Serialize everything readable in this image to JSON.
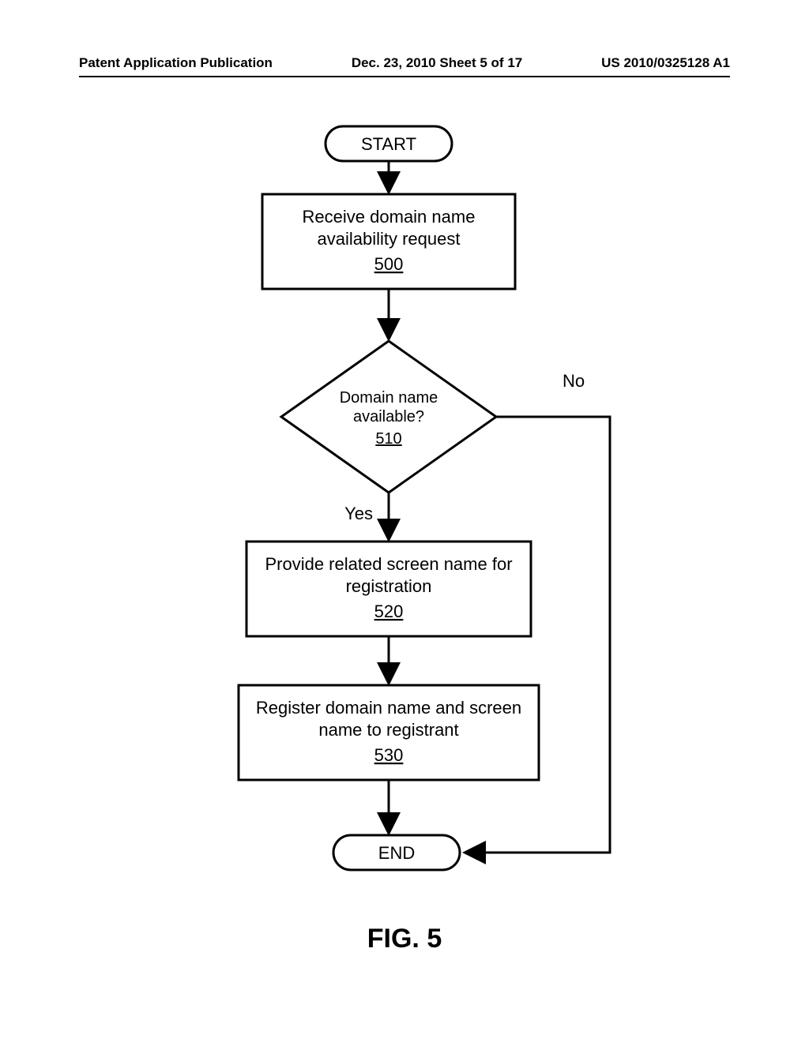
{
  "header": {
    "left": "Patent Application Publication",
    "center": "Dec. 23, 2010  Sheet 5 of 17",
    "right": "US 2010/0325128 A1"
  },
  "flowchart": {
    "start": "START",
    "end": "END",
    "nodes": {
      "n500": {
        "line1": "Receive domain name",
        "line2": "availability request",
        "ref": "500"
      },
      "n510": {
        "line1": "Domain name",
        "line2": "available?",
        "ref": "510"
      },
      "n520": {
        "line1": "Provide related screen name for",
        "line2": "registration",
        "ref": "520"
      },
      "n530": {
        "line1": "Register domain name and screen",
        "line2": "name to registrant",
        "ref": "530"
      }
    },
    "labels": {
      "yes": "Yes",
      "no": "No"
    }
  },
  "figure_label": "FIG. 5"
}
